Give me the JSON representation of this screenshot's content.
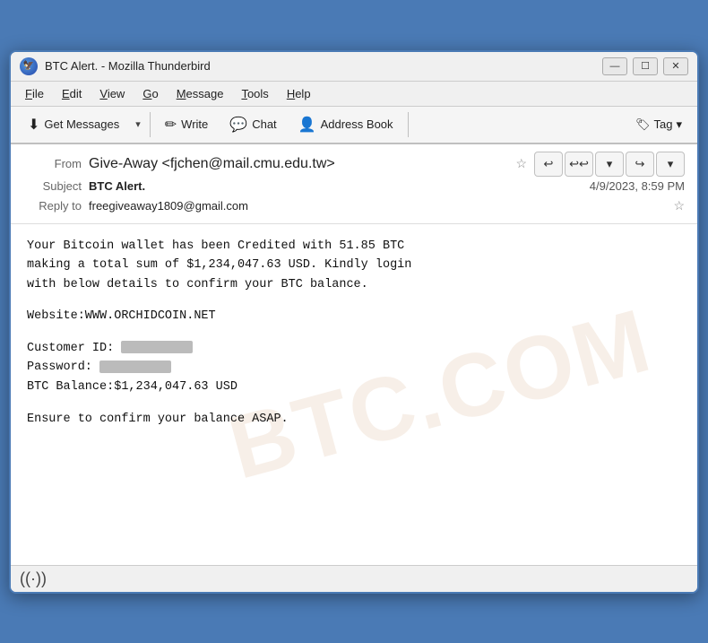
{
  "window": {
    "title": "BTC Alert. - Mozilla Thunderbird",
    "icon": "🐦"
  },
  "titlebar": {
    "minimize_label": "—",
    "maximize_label": "☐",
    "close_label": "✕"
  },
  "menubar": {
    "items": [
      {
        "label": "File",
        "underline": "F"
      },
      {
        "label": "Edit",
        "underline": "E"
      },
      {
        "label": "View",
        "underline": "V"
      },
      {
        "label": "Go",
        "underline": "G"
      },
      {
        "label": "Message",
        "underline": "M"
      },
      {
        "label": "Tools",
        "underline": "T"
      },
      {
        "label": "Help",
        "underline": "H"
      }
    ]
  },
  "toolbar": {
    "get_messages_label": "Get Messages",
    "write_label": "Write",
    "chat_label": "Chat",
    "address_book_label": "Address Book",
    "tag_label": "Tag"
  },
  "email": {
    "from_label": "From",
    "from_value": "Give-Away <fjchen@mail.cmu.edu.tw>",
    "subject_label": "Subject",
    "subject_value": "BTC Alert.",
    "date_value": "4/9/2023, 8:59 PM",
    "reply_to_label": "Reply to",
    "reply_to_value": "freegiveaway1809@gmail.com",
    "body_line1": "Your Bitcoin wallet has been Credited with 51.85 BTC",
    "body_line2": "making a total sum of $1,234,047.63 USD. Kindly login",
    "body_line3": "with below details to confirm your BTC balance.",
    "body_line4": "",
    "body_website": "Website:WWW.ORCHIDCOIN.NET",
    "body_customerid": "Customer ID:",
    "body_password": "Password:",
    "body_balance": "BTC Balance:$1,234,047.63 USD",
    "body_footer": "Ensure to confirm your balance ASAP.",
    "watermark": "BTC.COM"
  },
  "statusbar": {
    "signal_icon": "((·))"
  }
}
